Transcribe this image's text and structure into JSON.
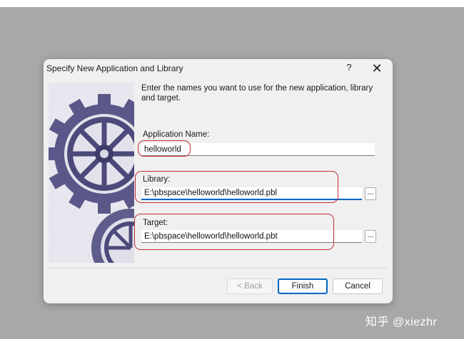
{
  "dialog": {
    "title": "Specify New Application and Library",
    "help_label": "?",
    "close_label": "✕",
    "intro": "Enter the names you want to use for the new application, library and target.",
    "app_name": {
      "label": "Application Name:",
      "value": "helloworld"
    },
    "library": {
      "label": "Library:",
      "value": "E:\\pbspace\\helloworld\\helloworld.pbl",
      "browse_label": "..."
    },
    "target": {
      "label": "Target:",
      "value": "E:\\pbspace\\helloworld\\helloworld.pbt",
      "browse_label": "..."
    },
    "buttons": {
      "back": "< Back",
      "finish": "Finish",
      "cancel": "Cancel"
    }
  },
  "watermark": "知乎 @xiezhr",
  "colors": {
    "accent": "#0067c0",
    "annotation": "#c0303a",
    "backdrop": "#a8a8a8"
  }
}
